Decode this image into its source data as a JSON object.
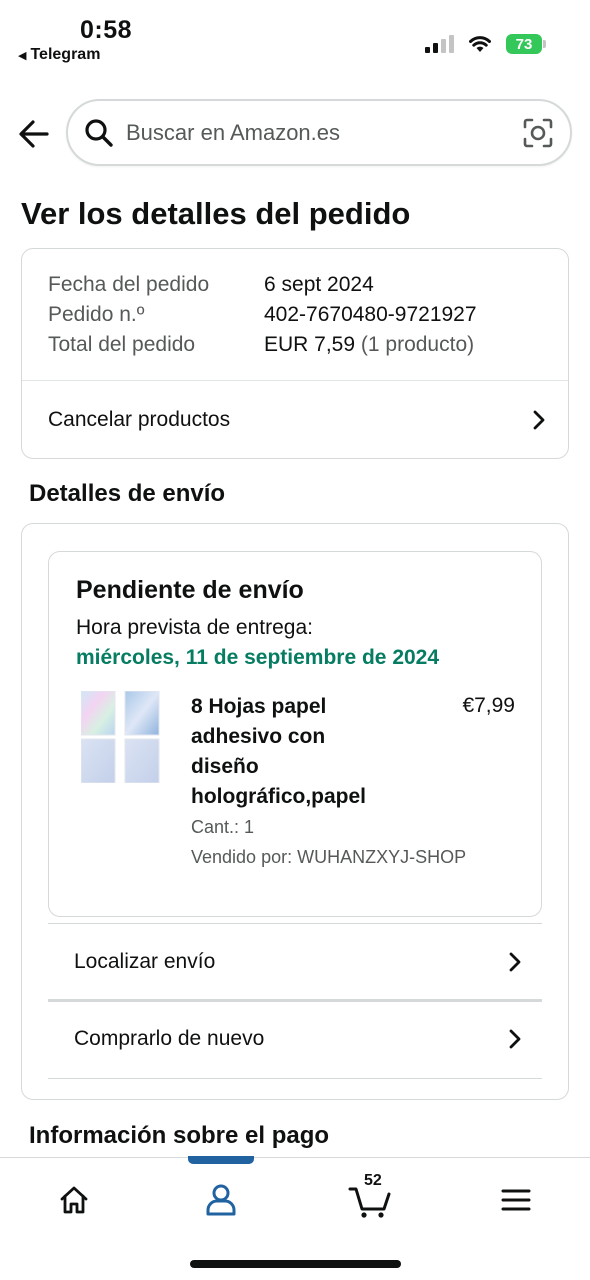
{
  "status_bar": {
    "time": "0:58",
    "back_app": "Telegram",
    "battery": "73"
  },
  "search": {
    "placeholder": "Buscar en Amazon.es"
  },
  "page_title": "Ver los detalles del pedido",
  "order_summary": {
    "rows": [
      {
        "label": "Fecha del pedido",
        "value": "6 sept 2024"
      },
      {
        "label": "Pedido n.º",
        "value": "402-7670480-9721927"
      },
      {
        "label": "Total del pedido",
        "value": "EUR 7,59",
        "suffix": "(1 producto)"
      }
    ],
    "cancel_label": "Cancelar productos"
  },
  "shipping": {
    "section_title": "Detalles de envío",
    "status": "Pendiente de envío",
    "delivery_label": "Hora prevista de entrega:",
    "delivery_date": "miércoles, 11 de septiembre de 2024",
    "product": {
      "title_lines": [
        "8 Hojas papel",
        "adhesivo con",
        "diseño",
        "holográfico,papel"
      ],
      "price": "€7,99",
      "quantity": "Cant.: 1",
      "seller": "Vendido por: WUHANZXYJ-SHOP"
    },
    "actions": [
      "Localizar envío",
      "Comprarlo de nuevo"
    ]
  },
  "payment": {
    "section_title": "Información sobre el pago"
  },
  "bottom_nav": {
    "cart_count": "52",
    "active_item": "account",
    "active_color": "#2162a1"
  },
  "colors": {
    "delivery_green": "#067d62",
    "text_primary": "#0f1111",
    "text_secondary": "#565959",
    "border": "#d5d9d9",
    "battery_green": "#34c759"
  }
}
